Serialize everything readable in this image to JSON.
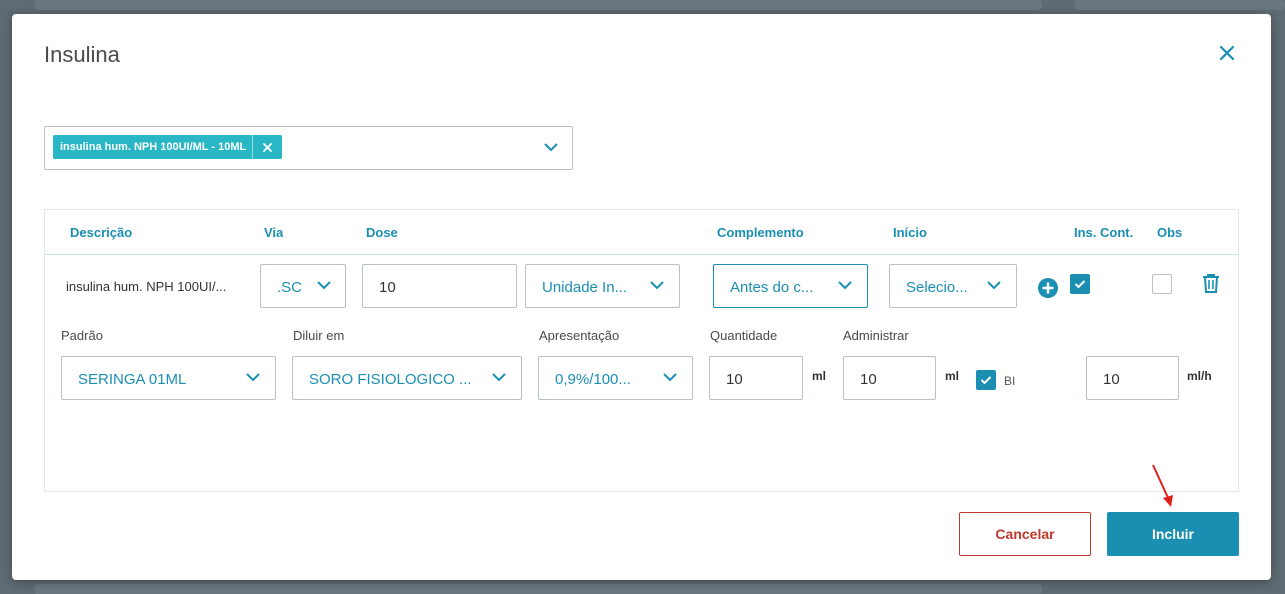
{
  "modal": {
    "title": "Insulina",
    "close_icon": "close-icon"
  },
  "med_select": {
    "tag_label": "insulina hum. NPH 100UI/ML - 10ML"
  },
  "table": {
    "headers": {
      "descricao": "Descrição",
      "via": "Via",
      "dose": "Dose",
      "complemento": "Complemento",
      "inicio": "Início",
      "ins_cont": "Ins. Cont.",
      "obs": "Obs"
    },
    "row": {
      "descricao": "insulina hum. NPH 100UI/...",
      "via": ".SC",
      "dose": "10",
      "dose_unit": "Unidade In...",
      "complemento": "Antes do c...",
      "inicio": "Selecio...",
      "ins_cont_checked": true,
      "obs_checked": false
    },
    "details": {
      "padrao_label": "Padrão",
      "padrao_value": "SERINGA 01ML",
      "diluir_label": "Diluir em",
      "diluir_value": "SORO FISIOLOGICO ...",
      "apresentacao_label": "Apresentação",
      "apresentacao_value": "0,9%/100...",
      "quantidade_label": "Quantidade",
      "quantidade_value": "10",
      "quantidade_unit": "ml",
      "administrar_label": "Administrar",
      "administrar_value": "10",
      "administrar_unit": "ml",
      "bi_label": "BI",
      "bi_checked": true,
      "rate_value": "10",
      "rate_unit": "ml/h"
    }
  },
  "footer": {
    "cancel_label": "Cancelar",
    "include_label": "Incluir"
  },
  "colors": {
    "accent": "#1a8fb2",
    "tag": "#29b6c5",
    "danger": "#c0392b"
  }
}
